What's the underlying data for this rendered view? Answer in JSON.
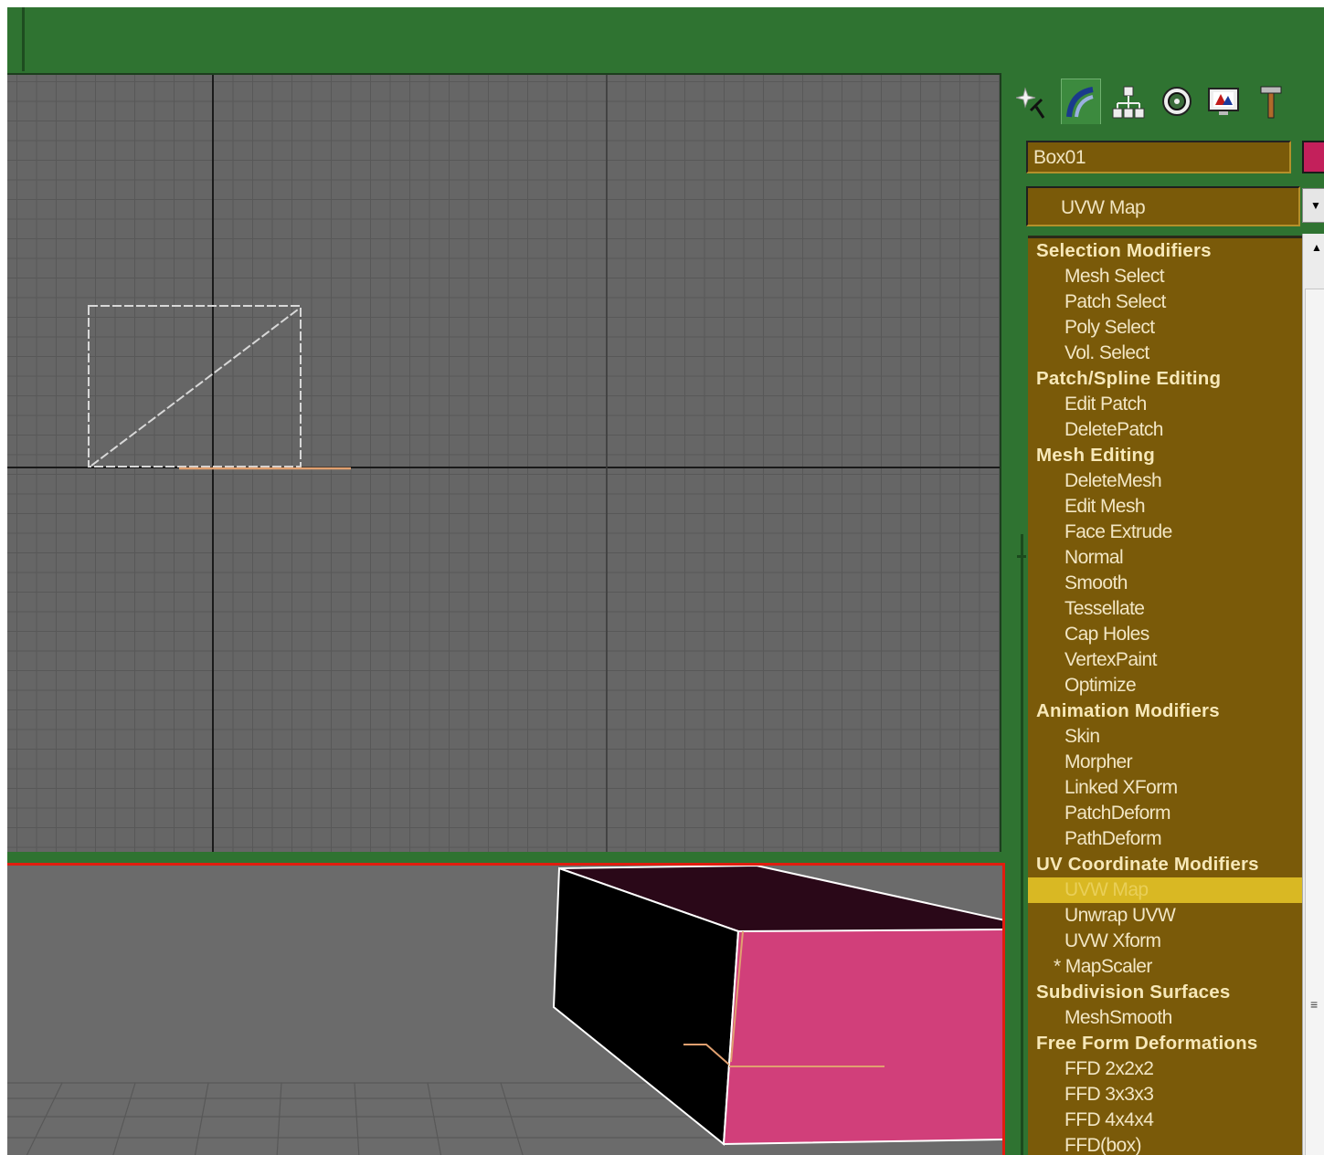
{
  "command_panel": {
    "tabs": [
      {
        "icon": "create-icon",
        "active": false
      },
      {
        "icon": "modify-icon",
        "active": true
      },
      {
        "icon": "hierarchy-icon",
        "active": false
      },
      {
        "icon": "motion-icon",
        "active": false
      },
      {
        "icon": "display-icon",
        "active": false
      },
      {
        "icon": "utilities-icon",
        "active": false
      }
    ],
    "object_name": "Box01",
    "object_color": "#c3205b",
    "modifier_dropdown_value": "UVW Map",
    "modifier_list": [
      {
        "type": "category",
        "label": "Selection Modifiers"
      },
      {
        "type": "mod",
        "label": "Mesh Select"
      },
      {
        "type": "mod",
        "label": "Patch Select"
      },
      {
        "type": "mod",
        "label": "Poly Select"
      },
      {
        "type": "mod",
        "label": "Vol. Select"
      },
      {
        "type": "category",
        "label": "Patch/Spline Editing"
      },
      {
        "type": "mod",
        "label": "Edit Patch"
      },
      {
        "type": "mod",
        "label": "DeletePatch"
      },
      {
        "type": "category",
        "label": "Mesh Editing"
      },
      {
        "type": "mod",
        "label": "DeleteMesh"
      },
      {
        "type": "mod",
        "label": "Edit Mesh"
      },
      {
        "type": "mod",
        "label": "Face Extrude"
      },
      {
        "type": "mod",
        "label": "Normal"
      },
      {
        "type": "mod",
        "label": "Smooth"
      },
      {
        "type": "mod",
        "label": "Tessellate"
      },
      {
        "type": "mod",
        "label": "Cap Holes"
      },
      {
        "type": "mod",
        "label": "VertexPaint"
      },
      {
        "type": "mod",
        "label": "Optimize"
      },
      {
        "type": "category",
        "label": "Animation Modifiers"
      },
      {
        "type": "mod",
        "label": "Skin"
      },
      {
        "type": "mod",
        "label": "Morpher"
      },
      {
        "type": "mod",
        "label": "Linked XForm"
      },
      {
        "type": "mod",
        "label": "PatchDeform"
      },
      {
        "type": "mod",
        "label": "PathDeform"
      },
      {
        "type": "category",
        "label": "UV Coordinate Modifiers"
      },
      {
        "type": "mod",
        "label": "UVW Map",
        "selected": true
      },
      {
        "type": "mod",
        "label": "Unwrap UVW"
      },
      {
        "type": "mod",
        "label": "UVW Xform"
      },
      {
        "type": "mod",
        "label": "* MapScaler",
        "starred": true
      },
      {
        "type": "category",
        "label": "Subdivision Surfaces"
      },
      {
        "type": "mod",
        "label": "MeshSmooth"
      },
      {
        "type": "category",
        "label": "Free Form Deformations"
      },
      {
        "type": "mod",
        "label": "FFD 2x2x2"
      },
      {
        "type": "mod",
        "label": "FFD 3x3x3"
      },
      {
        "type": "mod",
        "label": "FFD 4x4x4"
      },
      {
        "type": "mod",
        "label": "FFD(box)"
      }
    ]
  },
  "viewports": {
    "top": {
      "background": "#666666",
      "grid_color": "#585858"
    },
    "perspective": {
      "background": "#6b6b6b",
      "active_border": "#e11d0f",
      "object_color": "#d13f7a"
    }
  }
}
